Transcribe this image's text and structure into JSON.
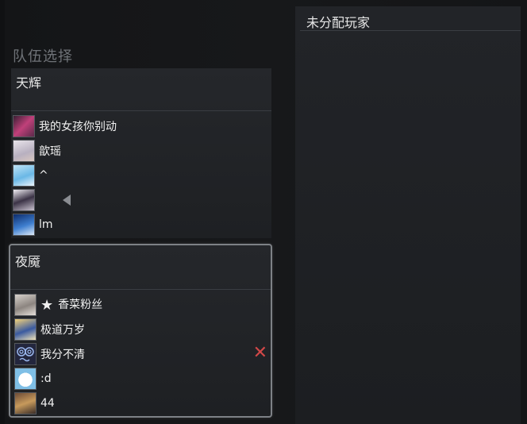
{
  "lobby": {
    "section_title": "队伍选择",
    "teams": [
      {
        "name": "天辉",
        "players": [
          {
            "name": "我的女孩你别动",
            "avatar": "pink-anime-avatar"
          },
          {
            "name": "歆瑶",
            "avatar": "white-hair-avatar"
          },
          {
            "name": "^",
            "avatar": "blue-hair-avatar"
          },
          {
            "name": "",
            "avatar": "dark-hair-avatar"
          },
          {
            "name": "lm",
            "avatar": "blue-night-avatar"
          }
        ]
      },
      {
        "name": "夜魇",
        "players": [
          {
            "name": "香菜粉丝",
            "avatar": "gray-avatar",
            "prefix_icon": "★"
          },
          {
            "name": "极道万岁",
            "avatar": "blonde-avatar"
          },
          {
            "name": "我分不清",
            "avatar": "swirl-eyes-avatar",
            "kick": "✕"
          },
          {
            "name": ":d",
            "avatar": "white-face-avatar"
          },
          {
            "name": "44",
            "avatar": "brown-avatar"
          }
        ]
      }
    ],
    "unassigned_title": "未分配玩家"
  },
  "colors": {
    "accent_kick": "#d24848",
    "selected_border": "#7d8186"
  }
}
